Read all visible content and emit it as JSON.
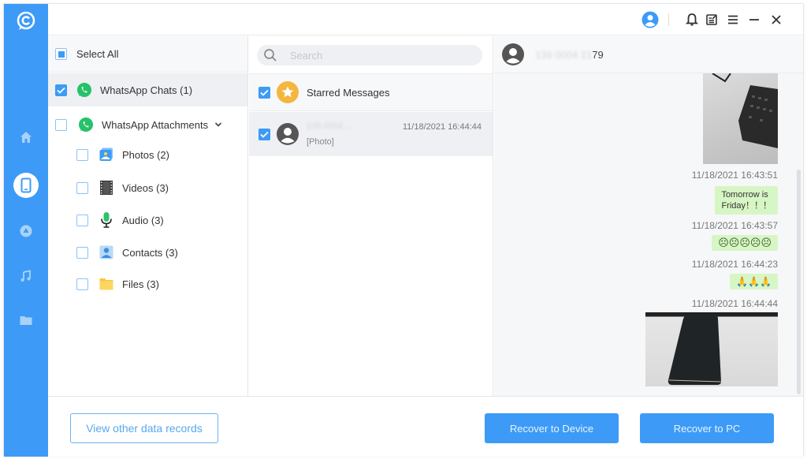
{
  "app": {
    "logo": "app-logo-icon"
  },
  "rail": {
    "items": [
      {
        "name": "home",
        "icon": "home-icon"
      },
      {
        "name": "device",
        "icon": "phone-icon",
        "active": true
      },
      {
        "name": "cloud",
        "icon": "cloud-icon"
      },
      {
        "name": "music",
        "icon": "music-icon"
      },
      {
        "name": "folder",
        "icon": "folder-icon"
      }
    ]
  },
  "topbar": {
    "icons": [
      "account-icon",
      "bell-icon",
      "feedback-icon",
      "menu-icon",
      "minimize-icon",
      "close-icon"
    ]
  },
  "categories": {
    "select_all": "Select All",
    "items": [
      {
        "label": "WhatsApp Chats (1)",
        "checked": true,
        "icon": "whatsapp-icon"
      },
      {
        "label": "WhatsApp Attachments",
        "checked": false,
        "icon": "whatsapp-icon",
        "expanded": true
      },
      {
        "label": "Photos (2)",
        "checked": false,
        "icon": "photos-icon"
      },
      {
        "label": "Videos (3)",
        "checked": false,
        "icon": "film-icon"
      },
      {
        "label": "Audio (3)",
        "checked": false,
        "icon": "microphone-icon"
      },
      {
        "label": "Contacts (3)",
        "checked": false,
        "icon": "contact-icon"
      },
      {
        "label": "Files (3)",
        "checked": false,
        "icon": "folder-icon"
      }
    ]
  },
  "chat_list": {
    "search_placeholder": "Search",
    "starred": {
      "label": "Starred Messages",
      "checked": true
    },
    "chats": [
      {
        "name": "139 0004 ...",
        "preview": "[Photo]",
        "time": "11/18/2021 16:44:44",
        "checked": true
      }
    ]
  },
  "conversation": {
    "contact_hidden": "139 0004 21",
    "contact_visible": "79",
    "messages": [
      {
        "type": "photo",
        "subject": "keyboard"
      },
      {
        "time": "11/18/2021 16:43:51",
        "type": "text",
        "text_line1": "Tomorrow is",
        "text_line2": "Friday！！！"
      },
      {
        "time": "11/18/2021 16:43:57",
        "type": "text",
        "text": "☹☹☹☹☹"
      },
      {
        "time": "11/18/2021 16:44:23",
        "type": "text",
        "text": "🙏🙏🙏"
      },
      {
        "time": "11/18/2021 16:44:44",
        "type": "photo",
        "subject": "phone"
      }
    ]
  },
  "footer": {
    "view_other": "View other data records",
    "recover_device": "Recover to Device",
    "recover_pc": "Recover to PC"
  },
  "colors": {
    "accent": "#3d9bf7",
    "bubble": "#d7f6c5",
    "whatsapp": "#25c26a",
    "star": "#f4b63f"
  }
}
